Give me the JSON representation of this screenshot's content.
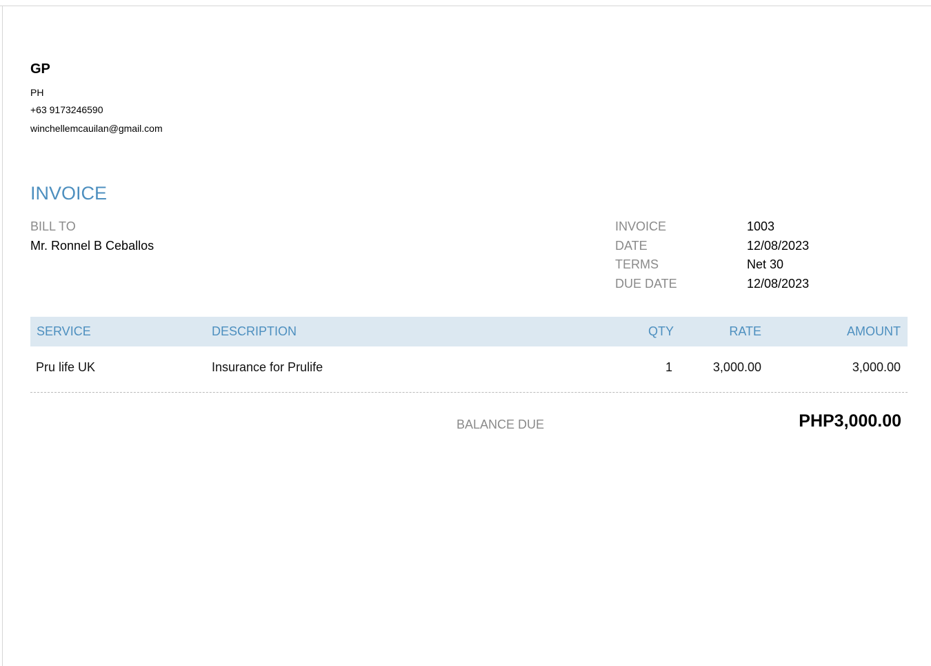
{
  "company": {
    "name": "GP",
    "country": "PH",
    "phone": "+63 9173246590",
    "email": "winchellemcauilan@gmail.com"
  },
  "document_title": "INVOICE",
  "bill_to": {
    "label": "BILL TO",
    "name": "Mr. Ronnel B Ceballos"
  },
  "meta": [
    {
      "label": "INVOICE",
      "value": "1003"
    },
    {
      "label": "DATE",
      "value": "12/08/2023"
    },
    {
      "label": "TERMS",
      "value": "Net 30"
    },
    {
      "label": "DUE DATE",
      "value": "12/08/2023"
    }
  ],
  "table": {
    "headers": {
      "service": "SERVICE",
      "description": "DESCRIPTION",
      "qty": "QTY",
      "rate": "RATE",
      "amount": "AMOUNT"
    },
    "rows": [
      {
        "service": "Pru life UK",
        "description": "Insurance for Prulife",
        "qty": "1",
        "rate": "3,000.00",
        "amount": "3,000.00"
      }
    ]
  },
  "balance": {
    "label": "BALANCE DUE",
    "amount": "PHP3,000.00"
  },
  "colors": {
    "accent": "#4d8fbf",
    "header_bg": "#dce8f1",
    "muted_text": "#8a8a8a"
  }
}
